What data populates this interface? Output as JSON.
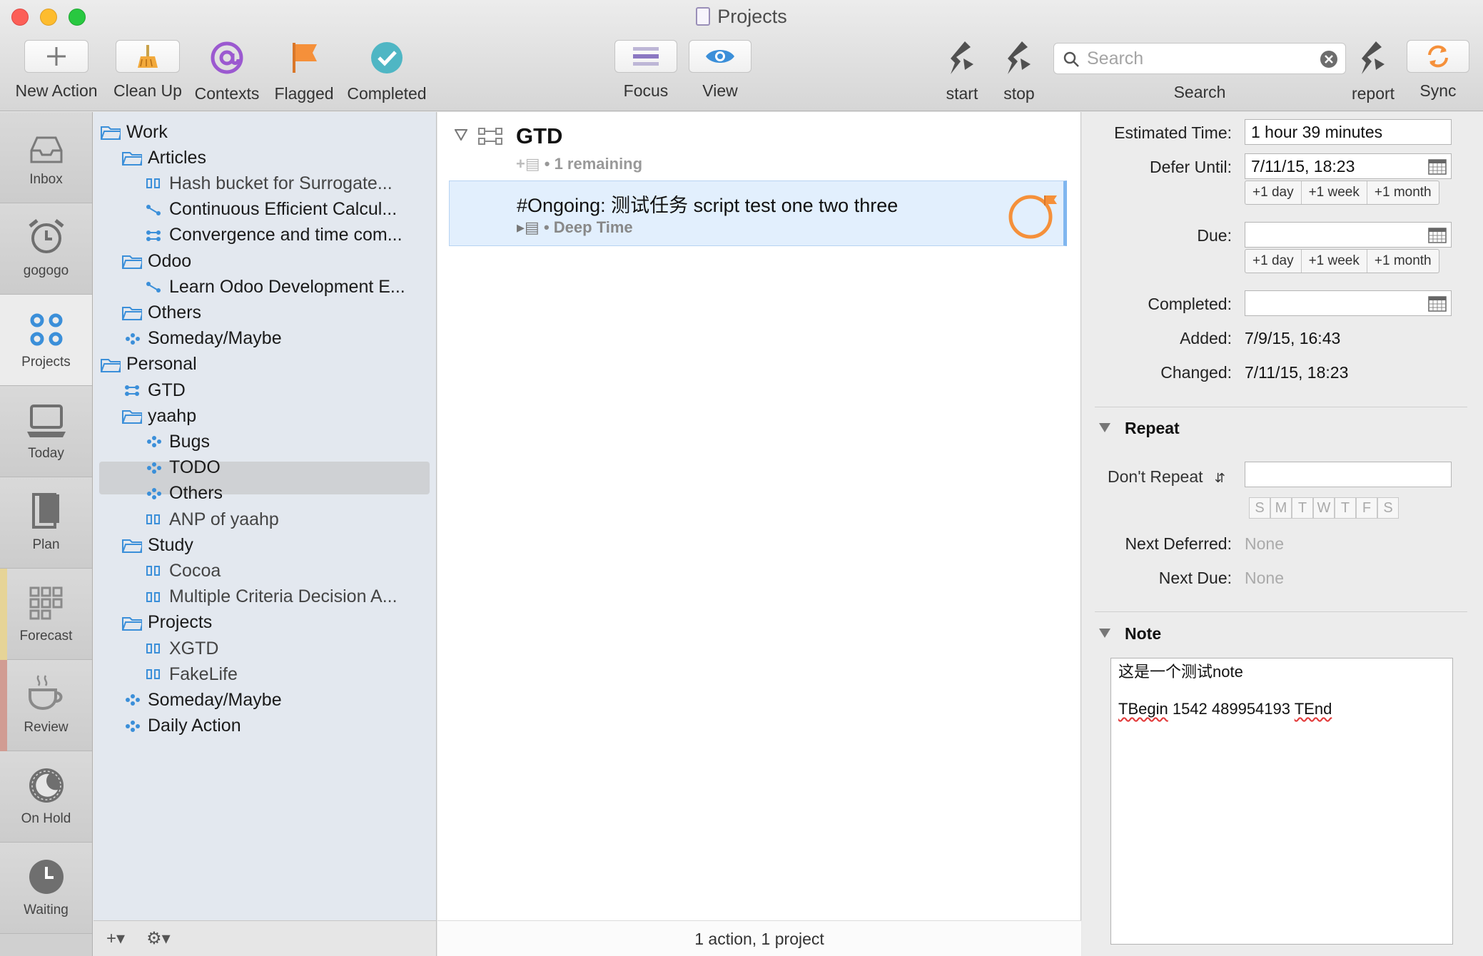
{
  "window": {
    "title": "Projects"
  },
  "toolbar": {
    "new_action": "New Action",
    "clean_up": "Clean Up",
    "contexts": "Contexts",
    "flagged": "Flagged",
    "completed": "Completed",
    "focus": "Focus",
    "view": "View",
    "start": "start",
    "stop": "stop",
    "search_placeholder": "Search",
    "search_label": "Search",
    "report": "report",
    "sync": "Sync"
  },
  "perspectives": [
    {
      "label": "Inbox",
      "icon": "inbox-icon"
    },
    {
      "label": "gogogo",
      "icon": "alarm-clock-icon"
    },
    {
      "label": "Projects",
      "icon": "projects-icon",
      "active": true
    },
    {
      "label": "Today",
      "icon": "laptop-icon"
    },
    {
      "label": "Plan",
      "icon": "book-icon"
    },
    {
      "label": "Forecast",
      "icon": "forecast-grid-icon",
      "accent": "#e6d497"
    },
    {
      "label": "Review",
      "icon": "coffee-cup-icon",
      "accent": "#d19c93"
    },
    {
      "label": "On Hold",
      "icon": "moon-icon"
    },
    {
      "label": "Waiting",
      "icon": "clock-icon"
    }
  ],
  "outline": [
    {
      "label": "Work",
      "type": "folder"
    },
    {
      "label": "Articles",
      "type": "folder"
    },
    {
      "label": "Hash bucket for Surrogate...",
      "type": "parallel"
    },
    {
      "label": "Continuous Efficient Calcul...",
      "type": "sequential"
    },
    {
      "label": "Convergence and time com...",
      "type": "project"
    },
    {
      "label": "Odoo",
      "type": "folder"
    },
    {
      "label": "Learn Odoo Development E...",
      "type": "sequential"
    },
    {
      "label": "Others",
      "type": "folder"
    },
    {
      "label": "Someday/Maybe",
      "type": "single"
    },
    {
      "label": "Personal",
      "type": "folder"
    },
    {
      "label": "GTD",
      "type": "project"
    },
    {
      "label": "yaahp",
      "type": "folder"
    },
    {
      "label": "Bugs",
      "type": "single"
    },
    {
      "label": "TODO",
      "type": "single"
    },
    {
      "label": "Others",
      "type": "single"
    },
    {
      "label": "ANP of yaahp",
      "type": "parallel"
    },
    {
      "label": "Study",
      "type": "folder"
    },
    {
      "label": "Cocoa",
      "type": "parallel"
    },
    {
      "label": "Multiple Criteria Decision A...",
      "type": "parallel"
    },
    {
      "label": "Projects",
      "type": "folder"
    },
    {
      "label": "XGTD",
      "type": "parallel"
    },
    {
      "label": "FakeLife",
      "type": "parallel"
    },
    {
      "label": "Someday/Maybe",
      "type": "single"
    },
    {
      "label": "Daily Action",
      "type": "single"
    }
  ],
  "project": {
    "title": "GTD",
    "remaining": "1 remaining",
    "task": {
      "title": "#Ongoing: 测试任务 script test one two three",
      "context": "Deep Time"
    },
    "status": "1 action, 1 project"
  },
  "inspector": {
    "estimated_time_label": "Estimated Time:",
    "estimated_time": "1 hour 39 minutes",
    "defer_label": "Defer Until:",
    "defer_until": "7/11/15, 18:23",
    "day": "+1 day",
    "week": "+1 week",
    "month": "+1 month",
    "due_label": "Due:",
    "due": "",
    "completed_label": "Completed:",
    "completed": "",
    "added_label": "Added:",
    "added": "7/9/15, 16:43",
    "changed_label": "Changed:",
    "changed": "7/11/15, 18:23",
    "repeat_header": "Repeat",
    "repeat_option": "Don't Repeat",
    "repeat_value": "",
    "days": [
      "S",
      "M",
      "T",
      "W",
      "T",
      "F",
      "S"
    ],
    "next_deferred_label": "Next Deferred:",
    "next_deferred": "None",
    "next_due_label": "Next Due:",
    "next_due": "None",
    "note_header": "Note",
    "note_line1": "这是一个测试note",
    "note_line2_a": "TBegin",
    "note_line2_b": " 1542 489954193 ",
    "note_line2_c": "TEnd"
  },
  "colors": {
    "accent_blue": "#3b8fd9",
    "flag_orange": "#f5903a",
    "selection": "#e2effd"
  }
}
